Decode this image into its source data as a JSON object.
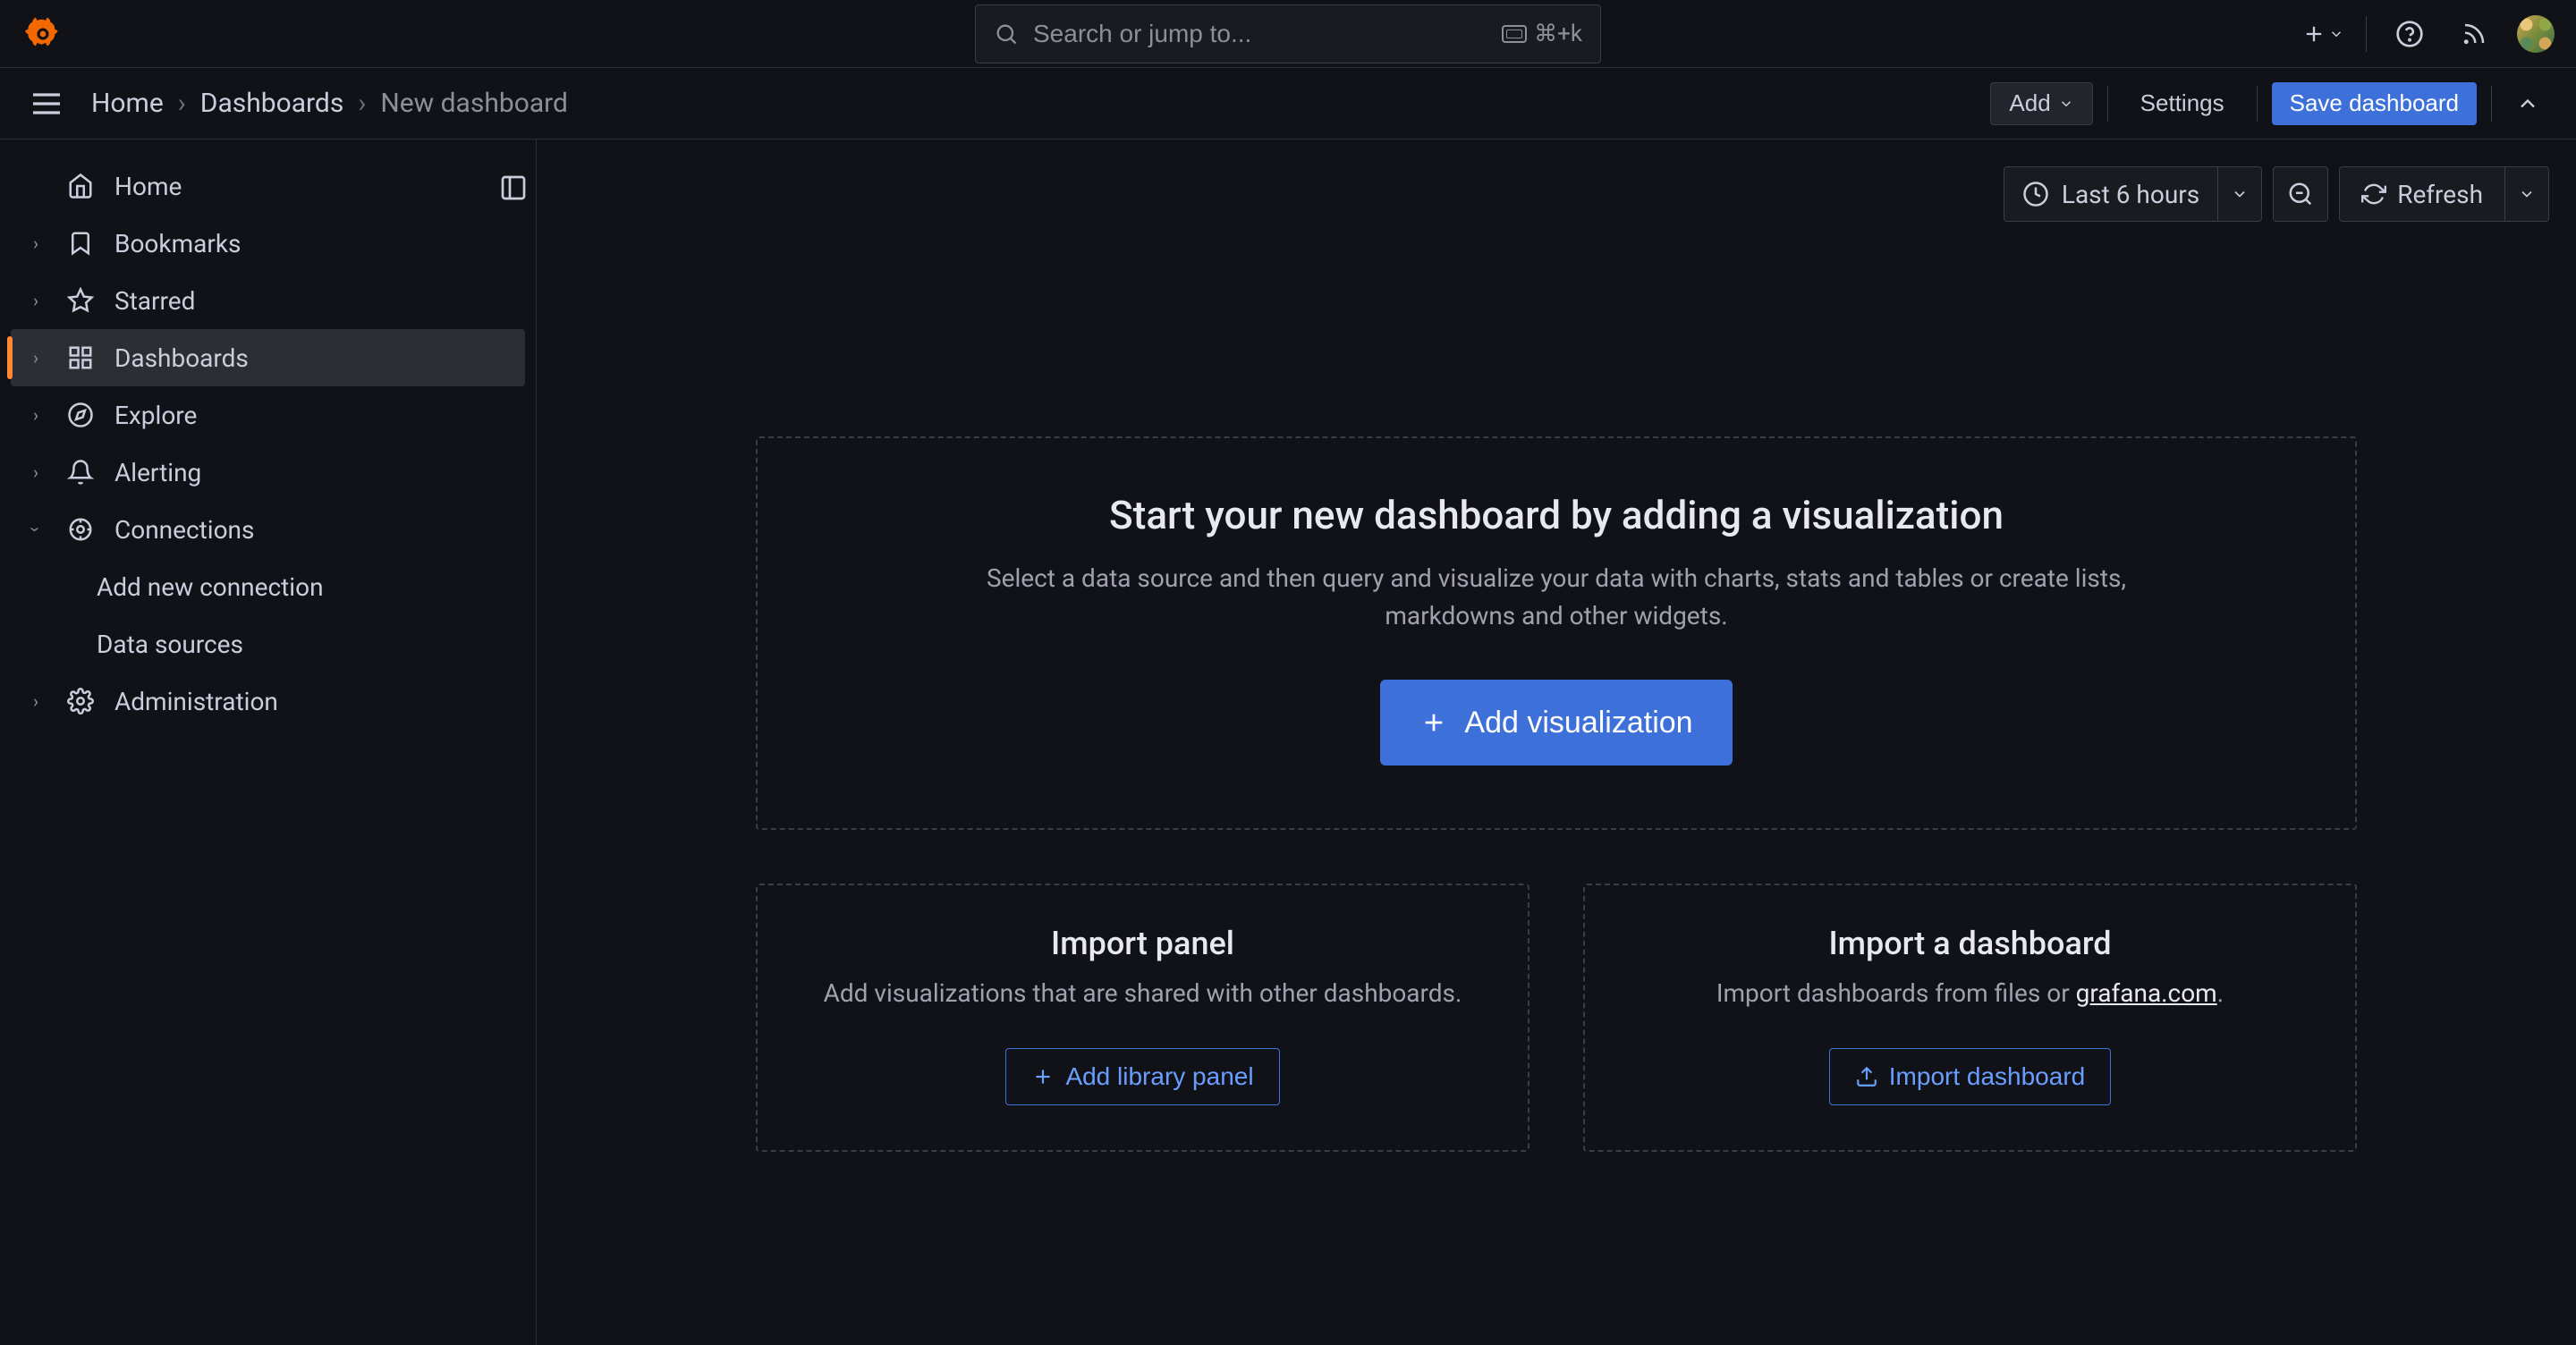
{
  "topbar": {
    "search_placeholder": "Search or jump to...",
    "kbd_hint": "⌘+k"
  },
  "breadcrumb": {
    "home": "Home",
    "dashboards": "Dashboards",
    "current": "New dashboard"
  },
  "subheader": {
    "add": "Add",
    "settings": "Settings",
    "save": "Save dashboard"
  },
  "sidebar": {
    "home": "Home",
    "bookmarks": "Bookmarks",
    "starred": "Starred",
    "dashboards": "Dashboards",
    "explore": "Explore",
    "alerting": "Alerting",
    "connections": "Connections",
    "add_connection": "Add new connection",
    "data_sources": "Data sources",
    "administration": "Administration"
  },
  "toolbar": {
    "time_label": "Last 6 hours",
    "refresh": "Refresh"
  },
  "hero": {
    "title": "Start your new dashboard by adding a visualization",
    "desc": "Select a data source and then query and visualize your data with charts, stats and tables or create lists, markdowns and other widgets.",
    "button": "Add visualization"
  },
  "card_panel": {
    "title": "Import panel",
    "desc": "Add visualizations that are shared with other dashboards.",
    "button": "Add library panel"
  },
  "card_dash": {
    "title": "Import a dashboard",
    "desc_prefix": "Import dashboards from files or ",
    "desc_link": "grafana.com",
    "desc_suffix": ".",
    "button": "Import dashboard"
  }
}
